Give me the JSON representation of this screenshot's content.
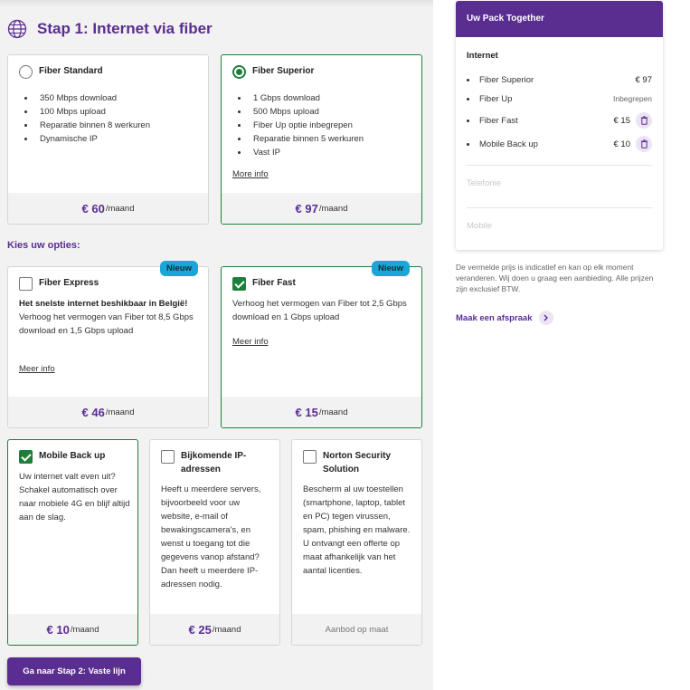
{
  "step": {
    "title": "Stap 1: Internet via fiber"
  },
  "plans": [
    {
      "name": "Fiber Standard",
      "features": [
        "350 Mbps download",
        "100 Mbps upload",
        "Reparatie binnen 8 werkuren",
        "Dynamische IP"
      ],
      "price": "€ 60",
      "per": "/maand",
      "selected": false
    },
    {
      "name": "Fiber Superior",
      "features": [
        "1 Gbps download",
        "500 Mbps upload",
        "Fiber Up optie inbegrepen",
        "Reparatie binnen 5 werkuren",
        "Vast IP"
      ],
      "link": "More info",
      "price": "€ 97",
      "per": "/maand",
      "selected": true
    }
  ],
  "options_label": "Kies uw opties:",
  "options": [
    {
      "name": "Fiber Express",
      "badge": "Nieuw",
      "desc_bold": "Het snelste internet beshikbaar in België!",
      "desc": "Verhoog het vermogen van Fiber tot 8,5 Gbps download en 1,5 Gbps upload",
      "link": "Meer info",
      "price": "€ 46",
      "per": "/maand",
      "checked": false
    },
    {
      "name": "Fiber Fast",
      "badge": "Nieuw",
      "desc": "Verhoog het vermogen van Fiber tot 2,5 Gbps download en 1 Gbps upload",
      "link": "Meer info",
      "price": "€ 15",
      "per": "/maand",
      "checked": true
    },
    {
      "name": "Mobile Back up",
      "desc": "Uw internet valt even uit? Schakel automatisch over naar mobiele 4G en blijf altijd aan de slag.",
      "price": "€ 10",
      "per": "/maand",
      "checked": true
    },
    {
      "name": "Bijkomende IP-adressen",
      "desc": "Heeft u meerdere servers, bijvoorbeeld voor uw website, e-mail of bewakingscamera's, en wenst u toegang tot die gegevens vanop afstand? Dan heeft u meerdere IP-adressen nodig.",
      "price": "€ 25",
      "per": "/maand",
      "checked": false
    },
    {
      "name": "Norton Security Solution",
      "desc": "Bescherm al uw toestellen (smartphone, laptop, tablet en PC) tegen virussen, spam, phishing en malware. U ontvangt een offerte op maat afhankelijk van het aantal licenties.",
      "price_text": "Aanbod op maat",
      "checked": false
    }
  ],
  "next_button": "Ga naar Stap 2: Vaste lijn",
  "summary": {
    "title": "Uw Pack Together",
    "internet_label": "Internet",
    "items": [
      {
        "name": "Fiber Superior",
        "value": "€ 97",
        "removable": false
      },
      {
        "name": "Fiber Up",
        "value": "Inbegrepen",
        "removable": false
      },
      {
        "name": "Fiber Fast",
        "value": "€ 15",
        "removable": true
      },
      {
        "name": "Mobile Back up",
        "value": "€ 10",
        "removable": true
      }
    ],
    "telefonie_label": "Telefonie",
    "mobile_label": "Mobile"
  },
  "disclaimer": "De vermelde prijs is indicatief en kan op elk moment veranderen. Wij doen u graag een aanbieding. Alle prijzen zijn exclusief BTW.",
  "appointment_link": "Maak een afspraak",
  "colors": {
    "brand_purple": "#5a2d91",
    "selected_green": "#1e7f3a",
    "badge_blue": "#1aa7d6"
  }
}
